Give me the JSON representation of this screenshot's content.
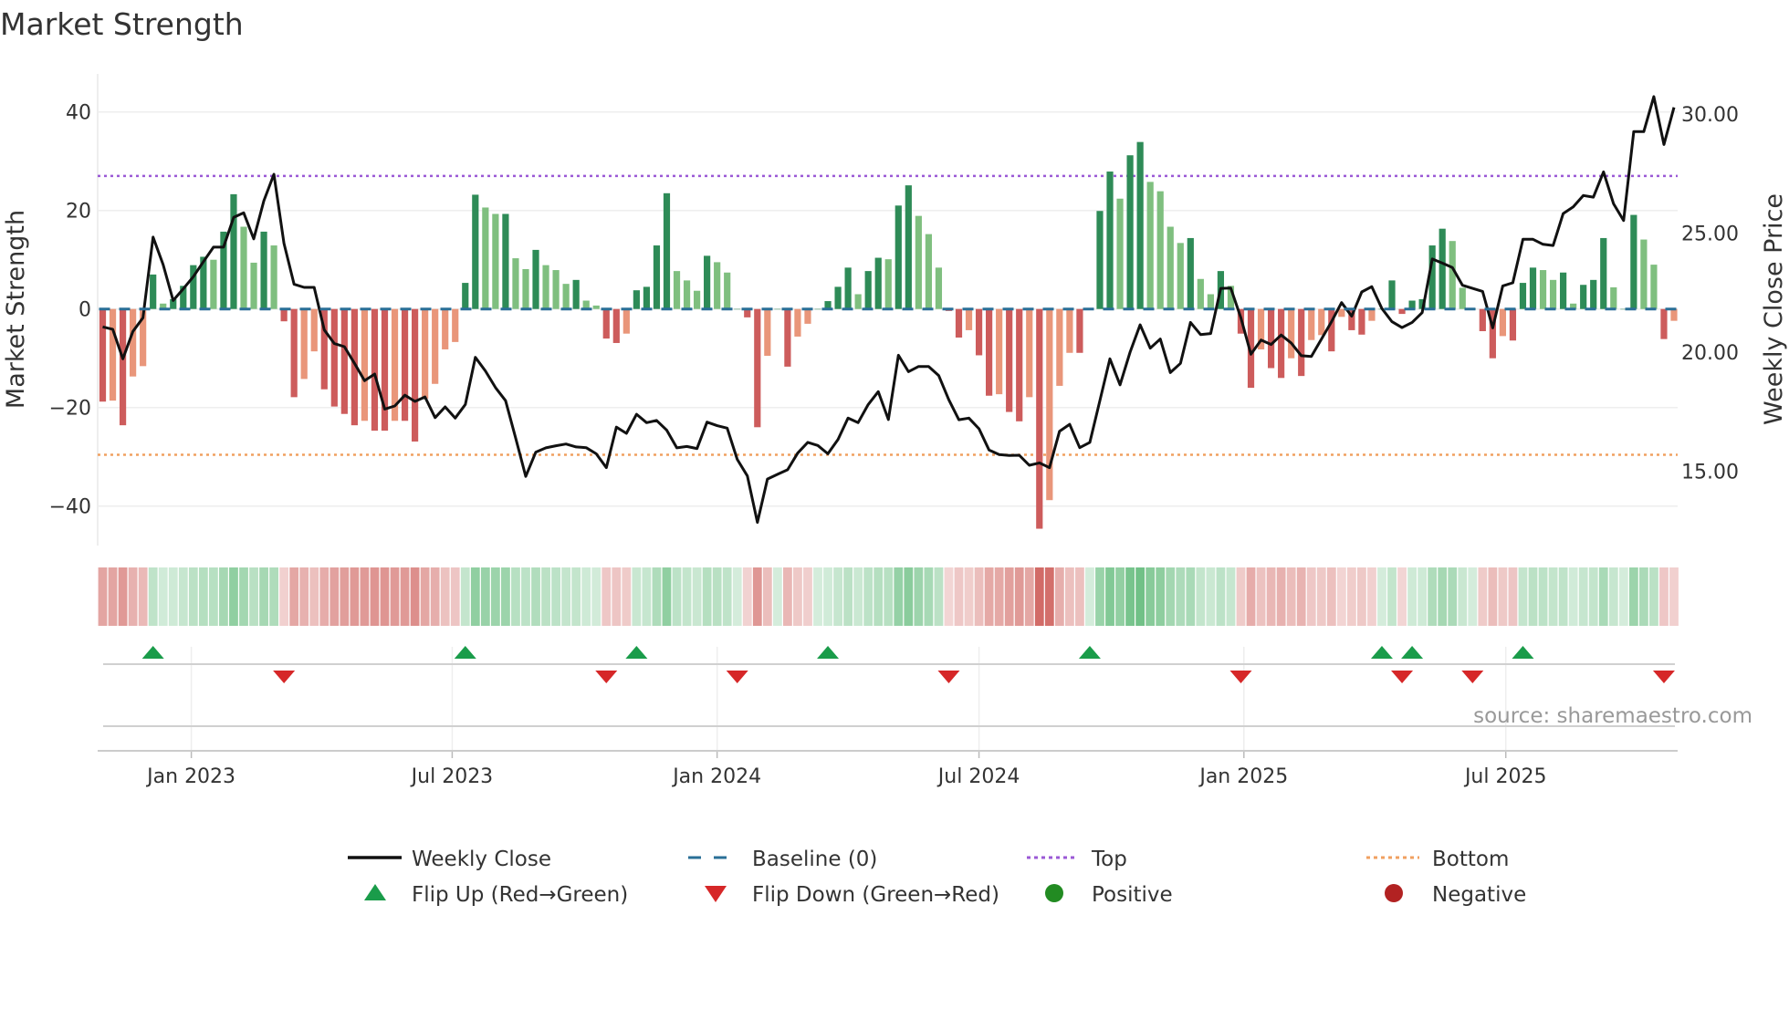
{
  "title": "Market Strength",
  "source": "source: sharemaestro.com",
  "colors": {
    "pos_dark": "#2e8b57",
    "pos_light": "#7fbf7f",
    "neg_dark": "#cd5c5c",
    "neg_light": "#e9967a",
    "baseline": "#2a6f97",
    "top": "#9b59d6",
    "bottom": "#f0a060",
    "flip_up": "#1a9c4a",
    "flip_down": "#d62728",
    "positive": "#228b22",
    "negative": "#b22222",
    "price": "#111111"
  },
  "legend": [
    {
      "label": "Weekly Close",
      "icon": "solid-line"
    },
    {
      "label": "Baseline (0)",
      "icon": "dashed-line"
    },
    {
      "label": "Top",
      "icon": "dotted-line-purple"
    },
    {
      "label": "Bottom",
      "icon": "dotted-line-orange"
    },
    {
      "label": "Flip Up (Red→Green)",
      "icon": "triangle-up"
    },
    {
      "label": "Flip Down (Green→Red)",
      "icon": "triangle-down"
    },
    {
      "label": "Positive",
      "icon": "circle-green"
    },
    {
      "label": "Negative",
      "icon": "circle-red"
    }
  ],
  "chart_data": {
    "type": "bar",
    "title": "Market Strength",
    "ylabel": "Market Strength",
    "y2label": "Weekly Close Price",
    "xlabel": "",
    "frequency": "weekly",
    "ylim": [
      -48,
      48
    ],
    "y2lim": [
      11.9,
      31.7
    ],
    "yticks": [
      "40",
      "20",
      "0",
      "−20",
      "−40"
    ],
    "ytick_values": [
      40,
      20,
      0,
      -20,
      -40
    ],
    "y2ticks": [
      "30.00",
      "25.00",
      "20.00",
      "15.00"
    ],
    "y2tick_values": [
      30,
      25,
      20,
      15
    ],
    "xticks": [
      "Jan 2023",
      "Jul 2023",
      "Jan 2024",
      "Jul 2024",
      "Jan 2025",
      "Jul 2025"
    ],
    "xtick_weeks": [
      8.8,
      34.7,
      61,
      87,
      113.3,
      139.3
    ],
    "top_level": 27,
    "bottom_level": -29.6,
    "baseline": 0,
    "strength": [
      -18.8,
      -18.6,
      -23.6,
      -13.7,
      -11.6,
      7,
      1.1,
      2,
      4.7,
      8.9,
      10.6,
      10,
      15.7,
      23.3,
      16.7,
      9.4,
      15.7,
      12.9,
      -2.5,
      -17.9,
      -14.2,
      -8.6,
      -16.3,
      -19.8,
      -21.3,
      -23.6,
      -22.7,
      -24.7,
      -24.7,
      -22.7,
      -22.7,
      -26.9,
      -18.2,
      -15.2,
      -8.2,
      -6.7,
      5.3,
      23.2,
      20.6,
      19.3,
      19.3,
      10.3,
      8.1,
      12,
      8.9,
      7.9,
      5.1,
      5.9,
      1.7,
      0.7,
      -6,
      -6.9,
      -5,
      3.8,
      4.5,
      12.9,
      23.5,
      7.7,
      5.8,
      3.7,
      10.8,
      9.5,
      7.4,
      0,
      -1.7,
      -24,
      -9.5,
      0,
      -11.7,
      -5.6,
      -3,
      0,
      1.6,
      4.5,
      8.4,
      3,
      7.7,
      10.4,
      10.1,
      21,
      25.1,
      18.9,
      15.2,
      8.4,
      -0.4,
      -5.8,
      -4.3,
      -9.4,
      -17.6,
      -17.3,
      -20.9,
      -22.8,
      -17.9,
      -44.6,
      -38.8,
      -15.6,
      -8.9,
      -8.9,
      0,
      19.9,
      27.9,
      22.4,
      31.2,
      33.9,
      25.8,
      23.9,
      16.7,
      13.4,
      14.4,
      6.1,
      3,
      7.7,
      4.7,
      -5,
      -16,
      -8.2,
      -12,
      -14,
      -10,
      -13.6,
      -6.3,
      -5.3,
      -8.6,
      -1.6,
      -4.3,
      -5.2,
      -2.4,
      0,
      5.8,
      -1,
      1.7,
      2,
      12.9,
      16.3,
      13.8,
      4.3,
      0,
      -4.5,
      -10,
      -5.5,
      -6.4,
      5.3,
      8.4,
      7.9,
      5.9,
      7.4,
      1.1,
      4.9,
      5.9,
      14.4,
      4.4,
      0,
      19.1,
      14.1,
      9,
      -6.1,
      -2.4
    ],
    "weekly_close": [
      21.06,
      20.96,
      19.72,
      20.87,
      21.44,
      24.83,
      23.68,
      22.17,
      22.66,
      23.17,
      23.8,
      24.41,
      24.41,
      25.66,
      25.85,
      24.76,
      26.36,
      27.47,
      24.57,
      22.85,
      22.72,
      22.72,
      20.93,
      20.36,
      20.23,
      19.53,
      18.8,
      19.08,
      17.61,
      17.74,
      18.19,
      17.93,
      18.12,
      17.25,
      17.7,
      17.23,
      17.8,
      19.78,
      19.21,
      18.51,
      17.96,
      16.4,
      14.78,
      15.8,
      15.98,
      16.07,
      16.14,
      16.02,
      15.99,
      15.73,
      15.15,
      16.85,
      16.59,
      17.39,
      17.04,
      17.13,
      16.72,
      15.98,
      16.04,
      15.95,
      17.06,
      16.91,
      16.81,
      15.5,
      14.8,
      12.85,
      14.67,
      14.87,
      15.06,
      15.76,
      16.21,
      16.08,
      15.73,
      16.33,
      17.23,
      17.04,
      17.8,
      18.34,
      17.17,
      19.87,
      19.18,
      19.4,
      19.4,
      19.02,
      18.0,
      17.16,
      17.23,
      16.78,
      15.89,
      15.7,
      15.66,
      15.67,
      15.25,
      15.35,
      15.15,
      16.68,
      16.97,
      15.99,
      16.21,
      17.96,
      19.72,
      18.63,
      20.0,
      21.15,
      20.17,
      20.55,
      19.14,
      19.53,
      21.25,
      20.74,
      20.78,
      22.68,
      22.69,
      21.44,
      19.91,
      20.51,
      20.32,
      20.72,
      20.38,
      19.85,
      19.82,
      20.55,
      21.28,
      22.08,
      21.51,
      22.53,
      22.75,
      21.83,
      21.28,
      21.03,
      21.25,
      21.66,
      23.91,
      23.74,
      23.55,
      22.81,
      22.68,
      22.55,
      21.02,
      22.78,
      22.91,
      24.74,
      24.74,
      24.53,
      24.48,
      25.82,
      26.1,
      26.58,
      26.51,
      27.57,
      26.23,
      25.53,
      29.26,
      29.26,
      30.73,
      28.72,
      30.28
    ],
    "flip_up_weeks": [
      5,
      36,
      53,
      72,
      98,
      127,
      130,
      141
    ],
    "flip_down_weeks": [
      18,
      50,
      63,
      84,
      113,
      129,
      136,
      155
    ],
    "legend_position": "bottom"
  }
}
